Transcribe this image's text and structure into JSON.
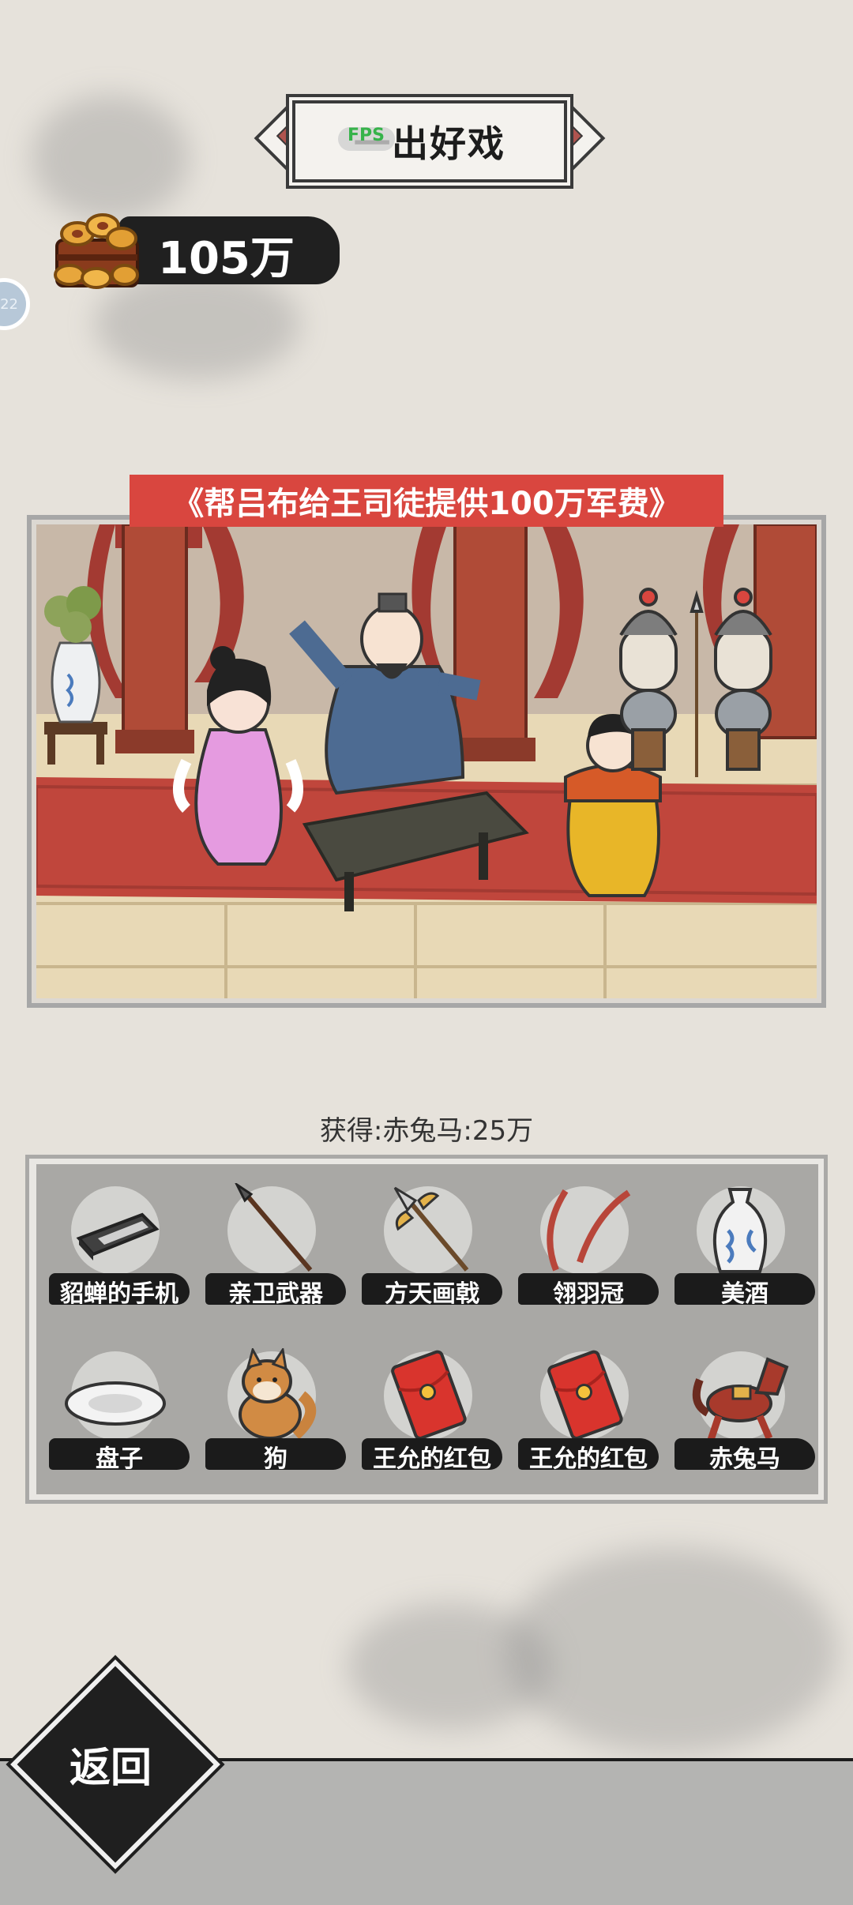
{
  "header": {
    "title": "一出好戏",
    "fps_label": "FPS"
  },
  "currency": {
    "value": "105万",
    "icon": "coin-chest-icon"
  },
  "side_badge": {
    "text": "22"
  },
  "quest": {
    "title": "《帮吕布给王司徒提供100万军费》"
  },
  "reward": {
    "text": "获得:赤兔马:25万"
  },
  "inventory": {
    "items": [
      {
        "label": "貂蝉的手机",
        "icon": "phone-icon"
      },
      {
        "label": "亲卫武器",
        "icon": "spear-icon"
      },
      {
        "label": "方天画戟",
        "icon": "halberd-icon"
      },
      {
        "label": "翎羽冠",
        "icon": "feather-crown-icon"
      },
      {
        "label": "美酒",
        "icon": "wine-vase-icon"
      },
      {
        "label": "盘子",
        "icon": "plate-icon"
      },
      {
        "label": "狗",
        "icon": "dog-icon"
      },
      {
        "label": "王允的红包",
        "icon": "red-envelope-icon"
      },
      {
        "label": "王允的红包",
        "icon": "red-envelope-icon"
      },
      {
        "label": "赤兔马",
        "icon": "horse-icon"
      }
    ]
  },
  "footer": {
    "back_label": "返回"
  },
  "colors": {
    "banner_red": "#d9463f",
    "background": "#e6e2db",
    "ink": "#1c1c1c"
  }
}
